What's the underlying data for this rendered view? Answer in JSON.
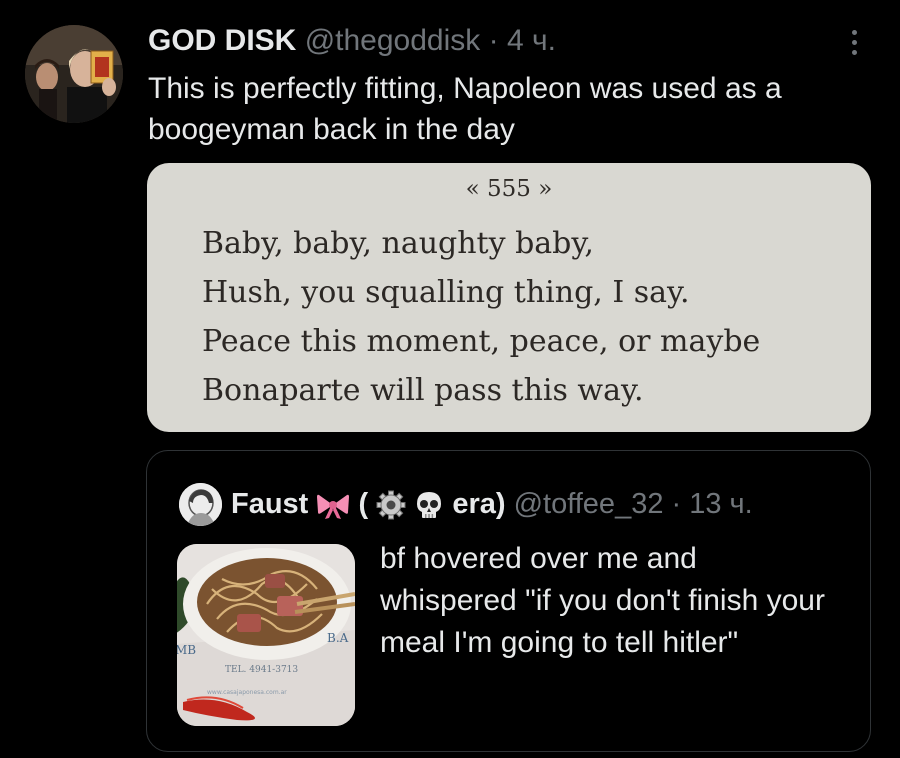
{
  "tweet": {
    "author_name": "GOD DISK",
    "handle": "@thegoddisk",
    "separator": " · ",
    "time": "4 ч.",
    "text": "This is perfectly fitting, Napoleon was used as a boogeyman back in the day",
    "avatar_icon": "avatar-photo-icon",
    "more_icon": "more-options-icon"
  },
  "media": {
    "page_number": "« 555 »",
    "poem": [
      "Baby, baby, naughty baby,",
      "Hush, you squalling thing, I say.",
      "Peace this moment, peace, or maybe",
      "Bonaparte will pass this way."
    ]
  },
  "quote": {
    "author_name": "Faust",
    "name_paren_open": " (",
    "name_suffix": " era)",
    "handle": "@toffee_32",
    "separator": " · ",
    "time": "13 ч.",
    "text": "bf hovered over me and whispered \"if you don't finish your meal I'm going to tell hitler\"",
    "emojis": [
      "ribbon-icon",
      "gear-icon",
      "skull-icon"
    ],
    "thumb_label_left": "MB",
    "thumb_label_right": "B.A",
    "thumb_phone": "TEL. 4941-3713",
    "thumb_url": "www.casajaponesa.com.ar"
  },
  "colors": {
    "background": "#000000",
    "text": "#e7e9ea",
    "muted": "#71767b",
    "border": "#2f3336"
  }
}
